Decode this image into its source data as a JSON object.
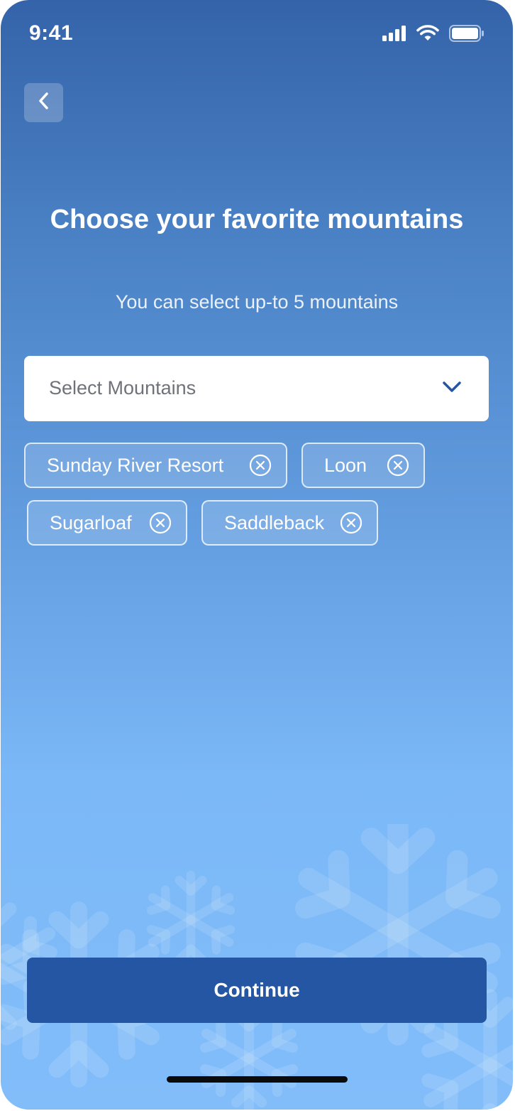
{
  "status_bar": {
    "time": "9:41",
    "icons": [
      "signal-icon",
      "wifi-icon",
      "battery-icon"
    ]
  },
  "header": {
    "back_icon": "chevron-left-icon",
    "title": "Choose your favorite mountains",
    "subtitle": "You can select up-to 5 mountains"
  },
  "select": {
    "placeholder": "Select Mountains",
    "icon": "chevron-down-icon"
  },
  "selected_mountains": [
    {
      "label": "Sunday River Resort",
      "remove_icon": "close-circle-icon"
    },
    {
      "label": "Loon",
      "remove_icon": "close-circle-icon"
    },
    {
      "label": "Sugarloaf",
      "remove_icon": "close-circle-icon"
    },
    {
      "label": "Saddleback",
      "remove_icon": "close-circle-icon"
    }
  ],
  "footer": {
    "continue_label": "Continue"
  },
  "colors": {
    "gradient_top": "#3463a9",
    "gradient_bottom": "#82bdfa",
    "button": "#2456a3",
    "select_chevron": "#2456a3"
  }
}
